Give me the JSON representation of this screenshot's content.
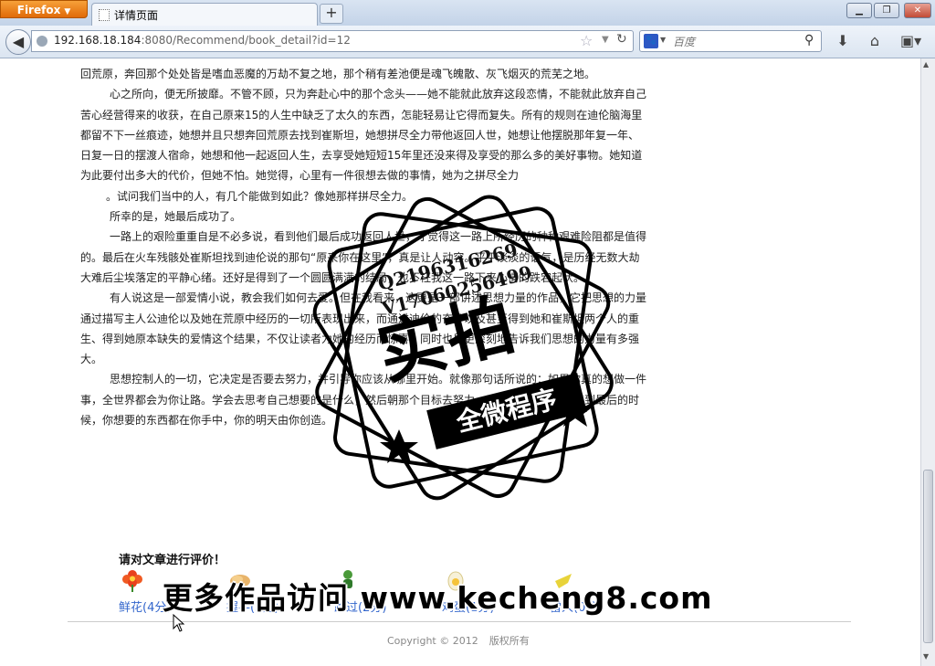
{
  "browser": {
    "app_button": "Firefox",
    "tab_title": "详情页面",
    "new_tab": "+",
    "url_host": "192.168.18.184",
    "url_rest": ":8080/Recommend/book_detail?id=12",
    "search_placeholder": "百度"
  },
  "article": {
    "paragraphs": [
      "回荒原，奔回那个处处皆是嗜血恶魔的万劫不复之地，那个稍有差池便是魂飞魄散、灰飞烟灭的荒芜之地。",
      "心之所向，便无所披靡。不管不顾，只为奔赴心中的那个念头——她不能就此放弃这段恋情，不能就此放弃自己苦心经营得来的收获，在自己原来15的人生中缺乏了太久的东西，怎能轻易让它得而复失。所有的规则在迪伦脑海里都留不下一丝痕迹，她想并且只想奔回荒原去找到崔斯坦，她想拼尽全力带他返回人世，她想让他摆脱那年复一年、日复一日的摆渡人宿命，她想和他一起返回人生，去享受她短短15年里还没来得及享受的那么多的美好事物。她知道为此要付出多大的代价，但她不怕。她觉得，心里有一件很想去做的事情，她为之拼尽全力",
      "。试问我们当中的人，有几个能做到如此？像她那样拼尽全力。",
      "所幸的是，她最后成功了。",
      "一路上的艰险重重自是不必多说，看到他们最后成功返回人世，才觉得这一路上所经历的种种艰难险阻都是值得的。最后在火车残骸处崔斯坦找到迪伦说的那句“原来你在这里”，真是让人动容。平平淡淡的语气，是历经无数大劫大难后尘埃落定的平静心绪。还好是得到了一个圆圆满满的结局，也不枉我这一路下来心情的跌宕起伏。",
      "有人说这是一部爱情小说，教会我们如何去爱。但在我看来，这更是一部讲述思想力量的作品，它把思想的力量通过描写主人公迪伦以及她在荒原中经历的一切所表现出来，而通过迪伦的奋斗以及甚至得到她和崔斯坦两个人的重生、得到她原本缺失的爱情这个结果，不仅让读者为她的经历而惊喜，同时也是更深刻地告诉我们思想的力量有多强大。",
      "思想控制人的一切，它决定是否要去努力，并引导你应该从哪里开始。就像那句话所说的：如果你真的想做一件事，全世界都会为你让路。学会去思考自己想要的是什么，然后朝那个目标去努力，坚持下去，你会发现到最后的时候，你想要的东西都在你手中，你的明天由你创造。"
    ]
  },
  "rating": {
    "title": "请对文章进行评价！",
    "options": [
      {
        "label": "鲜花(4分)",
        "icon": "flower-icon"
      },
      {
        "label": "握手(3分)",
        "icon": "handshake-icon"
      },
      {
        "label": "路过(2分)",
        "icon": "walk-icon"
      },
      {
        "label": "鸡蛋(1分)",
        "icon": "egg-icon"
      },
      {
        "label": "雷人(0分)",
        "icon": "thunder-icon"
      }
    ]
  },
  "footer": {
    "copyright": "Copyright © 2012",
    "rights": "版权所有"
  },
  "overlay": {
    "stamp_line1": "Q2196316269",
    "stamp_line2": "V17060256499",
    "stamp_big": "实拍",
    "stamp_band": "全微程序",
    "watermark": "更多作品访问 www.kecheng8.com"
  },
  "colors": {
    "link": "#3366cc",
    "firefox_orange": "#e67e1a"
  }
}
